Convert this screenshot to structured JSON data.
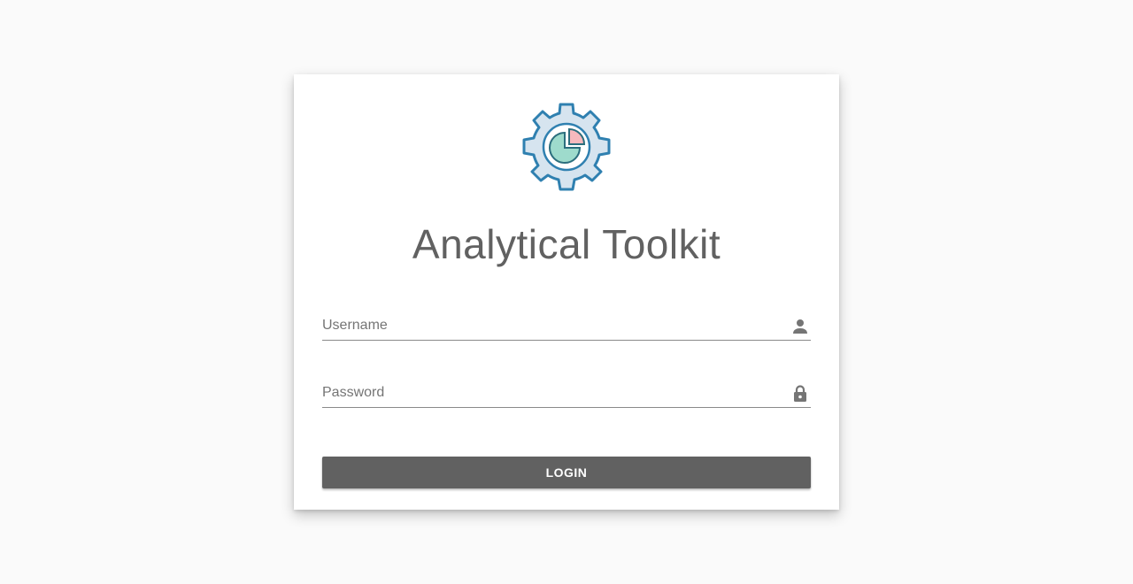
{
  "app": {
    "title": "Analytical Toolkit",
    "logo_icon": "gear-pie-chart-icon"
  },
  "form": {
    "username": {
      "placeholder": "Username",
      "value": "",
      "icon": "person-icon"
    },
    "password": {
      "placeholder": "Password",
      "value": "",
      "icon": "lock-icon"
    },
    "login_label": "LOGIN"
  },
  "colors": {
    "background": "#fafafa",
    "card": "#ffffff",
    "button": "#616161",
    "title_text": "#616161",
    "logo_outline": "#2f80b0",
    "logo_fill": "#d6e4ef",
    "pie_teal": "#9edbcc",
    "pie_pink": "#f6b9bd"
  }
}
